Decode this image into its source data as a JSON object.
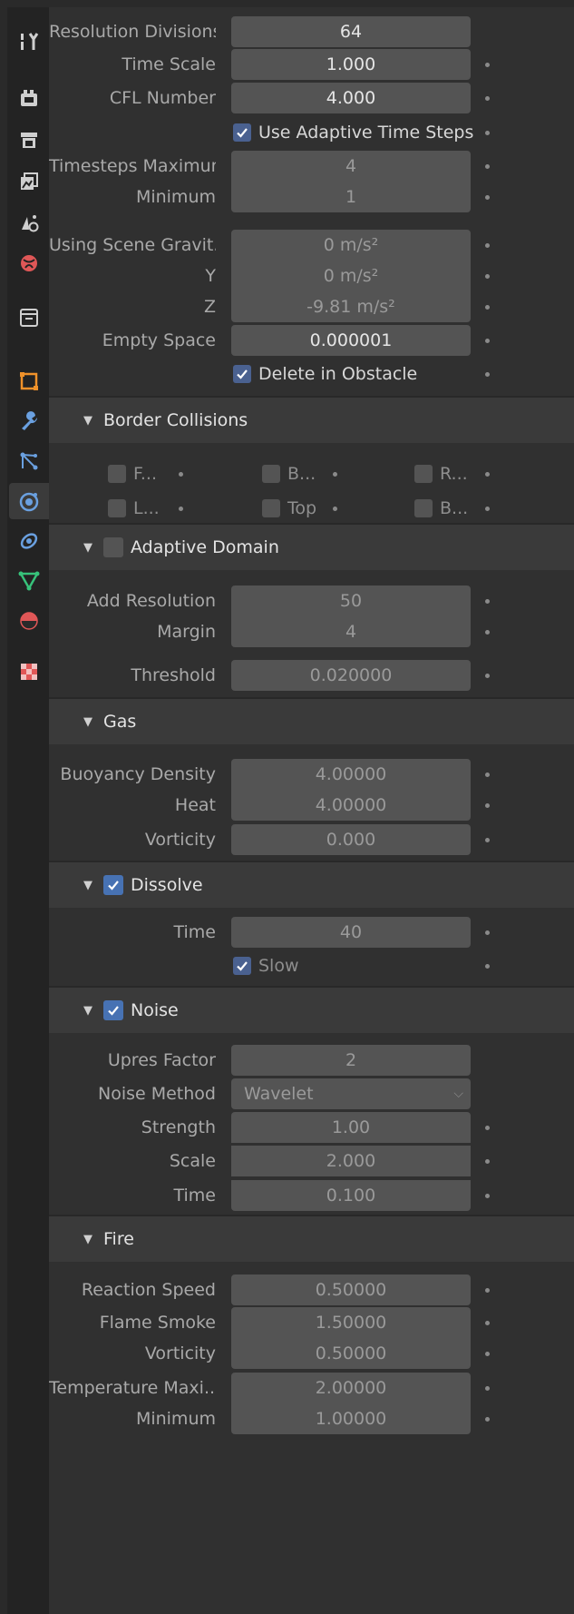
{
  "resolution": {
    "divisions_label": "Resolution Divisions",
    "divisions_value": "64",
    "time_scale_label": "Time Scale",
    "time_scale_value": "1.000",
    "cfl_label": "CFL Number",
    "cfl_value": "4.000",
    "adaptive_steps_label": "Use Adaptive Time Steps",
    "adaptive_steps_checked": true,
    "timesteps_max_label": "Timesteps Maximum",
    "timesteps_max_value": "4",
    "timesteps_min_label": "Minimum",
    "timesteps_min_value": "1",
    "gravity_label": "Using Scene Gravit...",
    "gravity_x": "0 m/s²",
    "gravity_y_label": "Y",
    "gravity_y": "0 m/s²",
    "gravity_z_label": "Z",
    "gravity_z": "-9.81 m/s²",
    "empty_space_label": "Empty Space",
    "empty_space_value": "0.000001",
    "delete_obstacle_label": "Delete in Obstacle",
    "delete_obstacle_checked": true
  },
  "border_collisions": {
    "title": "Border Collisions",
    "row1": [
      "F...",
      "B...",
      "R..."
    ],
    "row2": [
      "L...",
      "Top",
      "B..."
    ]
  },
  "adaptive_domain": {
    "title": "Adaptive Domain",
    "enabled": false,
    "add_resolution_label": "Add Resolution",
    "add_resolution_value": "50",
    "margin_label": "Margin",
    "margin_value": "4",
    "threshold_label": "Threshold",
    "threshold_value": "0.020000"
  },
  "gas": {
    "title": "Gas",
    "buoyancy_label": "Buoyancy Density",
    "buoyancy_value": "4.00000",
    "heat_label": "Heat",
    "heat_value": "4.00000",
    "vorticity_label": "Vorticity",
    "vorticity_value": "0.000"
  },
  "dissolve": {
    "title": "Dissolve",
    "enabled": true,
    "time_label": "Time",
    "time_value": "40",
    "slow_label": "Slow",
    "slow_checked": true
  },
  "noise": {
    "title": "Noise",
    "enabled": true,
    "upres_label": "Upres Factor",
    "upres_value": "2",
    "method_label": "Noise Method",
    "method_value": "Wavelet",
    "strength_label": "Strength",
    "strength_value": "1.00",
    "scale_label": "Scale",
    "scale_value": "2.000",
    "time_label": "Time",
    "time_value": "0.100"
  },
  "fire": {
    "title": "Fire",
    "reaction_label": "Reaction Speed",
    "reaction_value": "0.50000",
    "flame_smoke_label": "Flame Smoke",
    "flame_smoke_value": "1.50000",
    "vorticity_label": "Vorticity",
    "vorticity_value": "0.50000",
    "temp_max_label": "Temperature Maxi...",
    "temp_max_value": "2.00000",
    "temp_min_label": "Minimum",
    "temp_min_value": "1.00000"
  },
  "sidebar_tabs": [
    "tool-icon",
    "render-icon",
    "output-icon",
    "view-layer-icon",
    "scene-icon",
    "world-icon",
    "collection-icon",
    "object-icon",
    "modifier-icon",
    "particles-icon",
    "physics-icon",
    "constraints-icon",
    "data-icon",
    "material-icon",
    "texture-icon"
  ],
  "colors": {
    "accent": "#4772b3",
    "panel_bg": "#303030",
    "field_bg": "#545454",
    "header_bg": "#3a3a3a",
    "sidebar_bg": "#232323"
  }
}
